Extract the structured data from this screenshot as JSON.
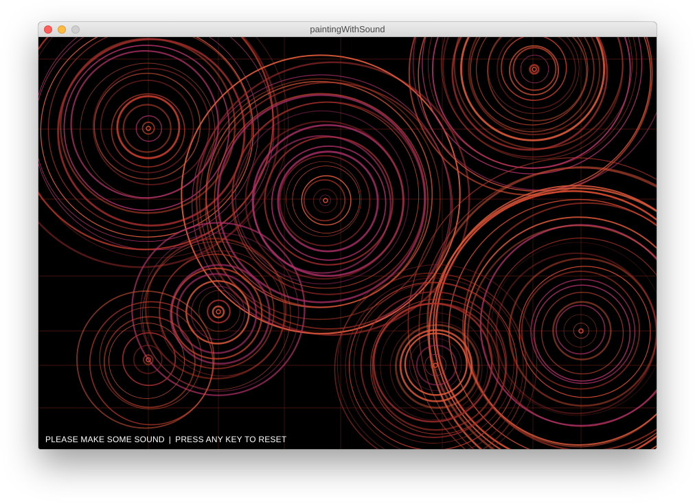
{
  "window": {
    "title": "paintingWithSound",
    "controls": {
      "close": "close",
      "minimize": "minimize",
      "zoom": "zoom"
    }
  },
  "status": {
    "left": "PLEASE MAKE SOME SOUND",
    "separator": "|",
    "right": "PRESS ANY KEY TO RESET"
  },
  "colors": {
    "background": "#000000",
    "ring_primary": "#c03a2a",
    "ring_secondary": "#d2492f",
    "ring_accent": "#b0306a",
    "grid_line": "#a83024"
  }
}
